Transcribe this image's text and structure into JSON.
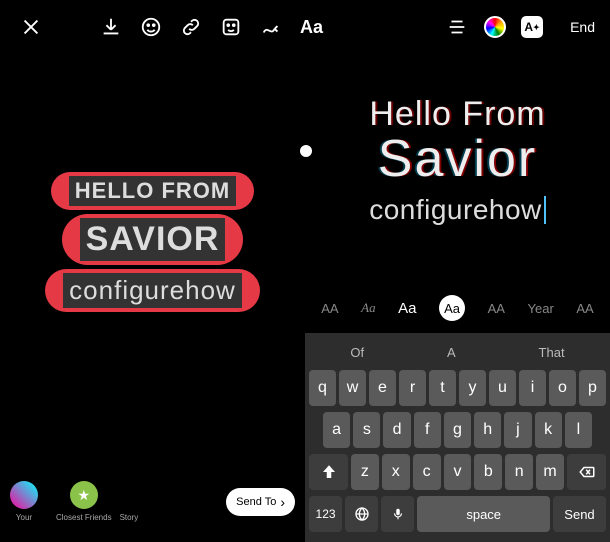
{
  "left": {
    "toolbar": {
      "close": "close",
      "download": "download",
      "emoji": "emoji",
      "link": "link",
      "sticker": "sticker",
      "draw": "draw",
      "text_label": "Aa"
    },
    "canvas": {
      "line1": "HELLO FROM",
      "line2": "SAVIOR",
      "line3": "configurehow"
    },
    "bottom": {
      "your_story": "Your",
      "closest_friends": "Closest Friends",
      "story": "Story",
      "send_to": "Send To"
    }
  },
  "right": {
    "toolbar": {
      "align": "align",
      "color": "color",
      "effect": "A",
      "end_label": "End"
    },
    "canvas": {
      "line1": "Hello From",
      "line2": "Savior",
      "line3": "configurehow"
    },
    "fonts": {
      "opt1": "AA",
      "opt2": "Aa",
      "opt3": "Aa",
      "opt3b": "Aa",
      "opt4": "AA",
      "opt5": "Year",
      "opt6": "AA"
    },
    "keyboard": {
      "sugg1": "Of",
      "sugg2": "A",
      "sugg3": "That",
      "row1": [
        "q",
        "w",
        "e",
        "r",
        "t",
        "y",
        "u",
        "i",
        "o",
        "p"
      ],
      "row2": [
        "a",
        "s",
        "d",
        "f",
        "g",
        "h",
        "j",
        "k",
        "l"
      ],
      "row3": [
        "z",
        "x",
        "c",
        "v",
        "b",
        "n",
        "m"
      ],
      "num_label": "123",
      "space_label": "space",
      "send_label": "Send"
    }
  }
}
